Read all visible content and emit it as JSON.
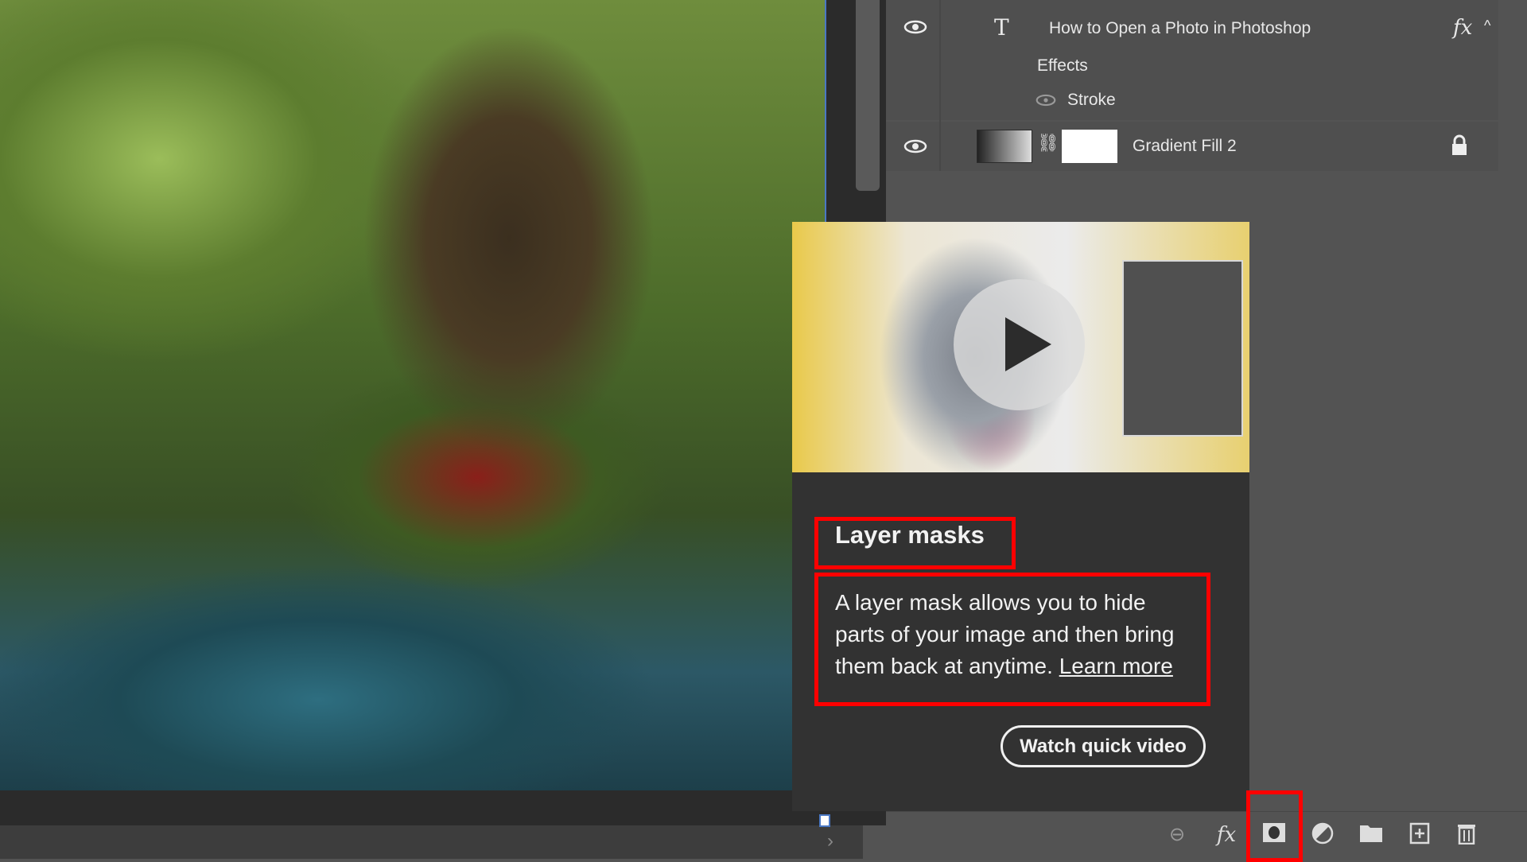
{
  "layers": {
    "text_layer": {
      "name": "How to Open a Photo in  Photoshop",
      "type_icon": "T",
      "fx_label": "fx"
    },
    "effects_label": "Effects",
    "stroke_label": "Stroke",
    "gradient_layer": {
      "name": "Gradient Fill 2"
    }
  },
  "tooltip": {
    "title": "Layer masks",
    "description": "A layer mask allows you to hide parts of your image and then bring them back at anytime.",
    "learn_more": "Learn more",
    "watch_button": "Watch quick video"
  },
  "toolbar": {
    "icons": [
      "link-icon",
      "fx-icon",
      "add-mask-icon",
      "adjustment-icon",
      "folder-icon",
      "new-layer-icon",
      "trash-icon"
    ],
    "fx_label": "fx"
  },
  "colors": {
    "highlight": "#ff0000",
    "panel": "#535353",
    "tooltip_bg": "#323232"
  }
}
